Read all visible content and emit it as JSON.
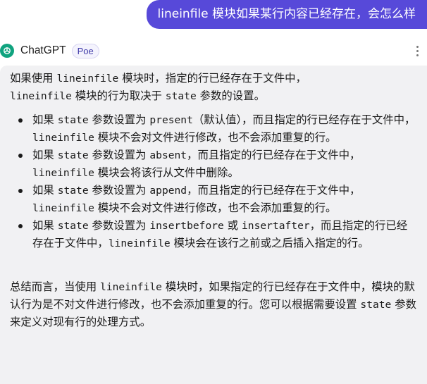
{
  "user_message": "lineinfile 模块如果某行内容已经存在，会怎么样",
  "bot": {
    "name": "ChatGPT",
    "tag": "Poe"
  },
  "answer": {
    "intro": {
      "t1": "如果使用 ",
      "c1": "lineinfile",
      "t2": " 模块时，指定的行已经存在于文件中，",
      "c2": "lineinfile",
      "t3": " 模块的行为取决于 ",
      "c3": "state",
      "t4": " 参数的设置。"
    },
    "bullets": [
      {
        "t1": "如果 ",
        "c1": "state",
        "t2": " 参数设置为 ",
        "c2": "present",
        "t3": "（默认值），而且指定的行已经存在于文件中，",
        "c3": "lineinfile",
        "t4": " 模块不会对文件进行修改，也不会添加重复的行。"
      },
      {
        "t1": "如果 ",
        "c1": "state",
        "t2": " 参数设置为 ",
        "c2": "absent",
        "t3": "，而且指定的行已经存在于文件中，",
        "c3": "lineinfile",
        "t4": " 模块会将该行从文件中删除。"
      },
      {
        "t1": "如果 ",
        "c1": "state",
        "t2": " 参数设置为 ",
        "c2": "append",
        "t3": "，而且指定的行已经存在于文件中，",
        "c3": "lineinfile",
        "t4": " 模块不会对文件进行修改，也不会添加重复的行。"
      },
      {
        "t1": "如果 ",
        "c1": "state",
        "t2": " 参数设置为 ",
        "c2": "insertbefore",
        "t2b": " 或 ",
        "c2b": "insertafter",
        "t3": "，而且指定的行已经存在于文件中，",
        "c3": "lineinfile",
        "t4": " 模块会在该行之前或之后插入指定的行。"
      }
    ],
    "summary": {
      "t1": "总结而言，当使用 ",
      "c1": "lineinfile",
      "t2": " 模块时，如果指定的行已经存在于文件中，模块的默认行为是不对文件进行修改，也不会添加重复的行。您可以根据需要设置 ",
      "c2": "state",
      "t3": " 参数来定义对现有行的处理方式。"
    }
  },
  "colors": {
    "user_bubble": "#5749d9",
    "answer_bg": "#f1f1f3",
    "bot_avatar": "#10a37f"
  },
  "icons": {
    "bot_avatar": "openai-logo-icon",
    "more": "more-vertical-icon"
  }
}
